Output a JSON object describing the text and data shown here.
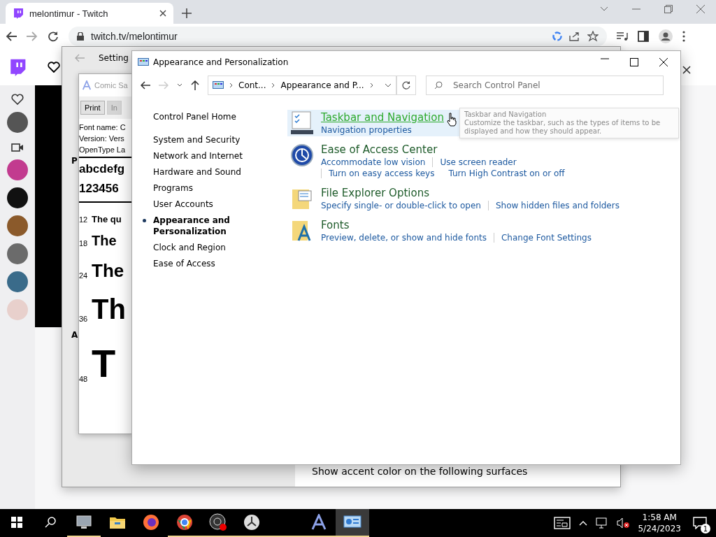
{
  "browser": {
    "tab_title": "melontimur - Twitch",
    "url": "twitch.tv/melontimur"
  },
  "settings_window": {
    "title": "Setting",
    "sidebar_letters": [
      "P",
      "A"
    ],
    "accent_label": "Show accent color on the following surfaces"
  },
  "font_viewer": {
    "title": "Comic Sa",
    "buttons": [
      {
        "label": "Print",
        "disabled": false
      },
      {
        "label": "In",
        "disabled": true
      }
    ],
    "info": [
      "Font name: C",
      "Version: Vers",
      "OpenType La"
    ],
    "alphabet": "abcdefg",
    "digits": "123456",
    "samples": [
      {
        "size": "12",
        "text": "The qu"
      },
      {
        "size": "18",
        "text": "The"
      },
      {
        "size": "24",
        "text": "The"
      },
      {
        "size": "36",
        "text": "Th"
      },
      {
        "size": "48",
        "text": "T"
      }
    ]
  },
  "control_panel": {
    "title": "Appearance and Personalization",
    "breadcrumb": [
      "Cont...",
      "Appearance and P..."
    ],
    "search_placeholder": "Search Control Panel",
    "nav": [
      {
        "label": "Control Panel Home",
        "selected": false
      },
      {
        "label": "System and Security",
        "selected": false
      },
      {
        "label": "Network and Internet",
        "selected": false
      },
      {
        "label": "Hardware and Sound",
        "selected": false
      },
      {
        "label": "Programs",
        "selected": false
      },
      {
        "label": "User Accounts",
        "selected": false
      },
      {
        "label": "Appearance and Personalization",
        "selected": true
      },
      {
        "label": "Clock and Region",
        "selected": false
      },
      {
        "label": "Ease of Access",
        "selected": false
      }
    ],
    "sections": [
      {
        "kind": "taskbar",
        "title": "Taskbar and Navigation",
        "hovered": true,
        "links": [
          "Navigation properties"
        ]
      },
      {
        "kind": "access",
        "title": "Ease of Access Center",
        "hovered": false,
        "links": [
          "Accommodate low vision",
          "Use screen reader",
          "Turn on easy access keys",
          "Turn High Contrast on or off"
        ]
      },
      {
        "kind": "explorer",
        "title": "File Explorer Options",
        "hovered": false,
        "links": [
          "Specify single- or double-click to open",
          "Show hidden files and folders"
        ]
      },
      {
        "kind": "fonts",
        "title": "Fonts",
        "hovered": false,
        "links": [
          "Preview, delete, or show and hide fonts",
          "Change Font Settings"
        ]
      }
    ],
    "tooltip": {
      "title": "Taskbar and Navigation",
      "text": "Customize the taskbar, such as the types of items to be displayed and how they should appear."
    }
  },
  "taskbar": {
    "apps": [
      {
        "kind": "monitor",
        "running": true,
        "selected": false
      },
      {
        "kind": "folder",
        "running": false,
        "selected": false
      },
      {
        "kind": "firefox",
        "running": false,
        "selected": false
      },
      {
        "kind": "chrome",
        "running": true,
        "selected": false
      },
      {
        "kind": "obs",
        "running": true,
        "selected": false
      },
      {
        "kind": "clock",
        "running": true,
        "selected": false
      },
      {
        "kind": "blank",
        "running": true,
        "selected": false
      },
      {
        "kind": "fontviewer",
        "running": true,
        "selected": false
      },
      {
        "kind": "controlpanel",
        "running": true,
        "selected": true
      }
    ],
    "time": "1:58 AM",
    "date": "5/24/2023",
    "notification_count": "1"
  }
}
